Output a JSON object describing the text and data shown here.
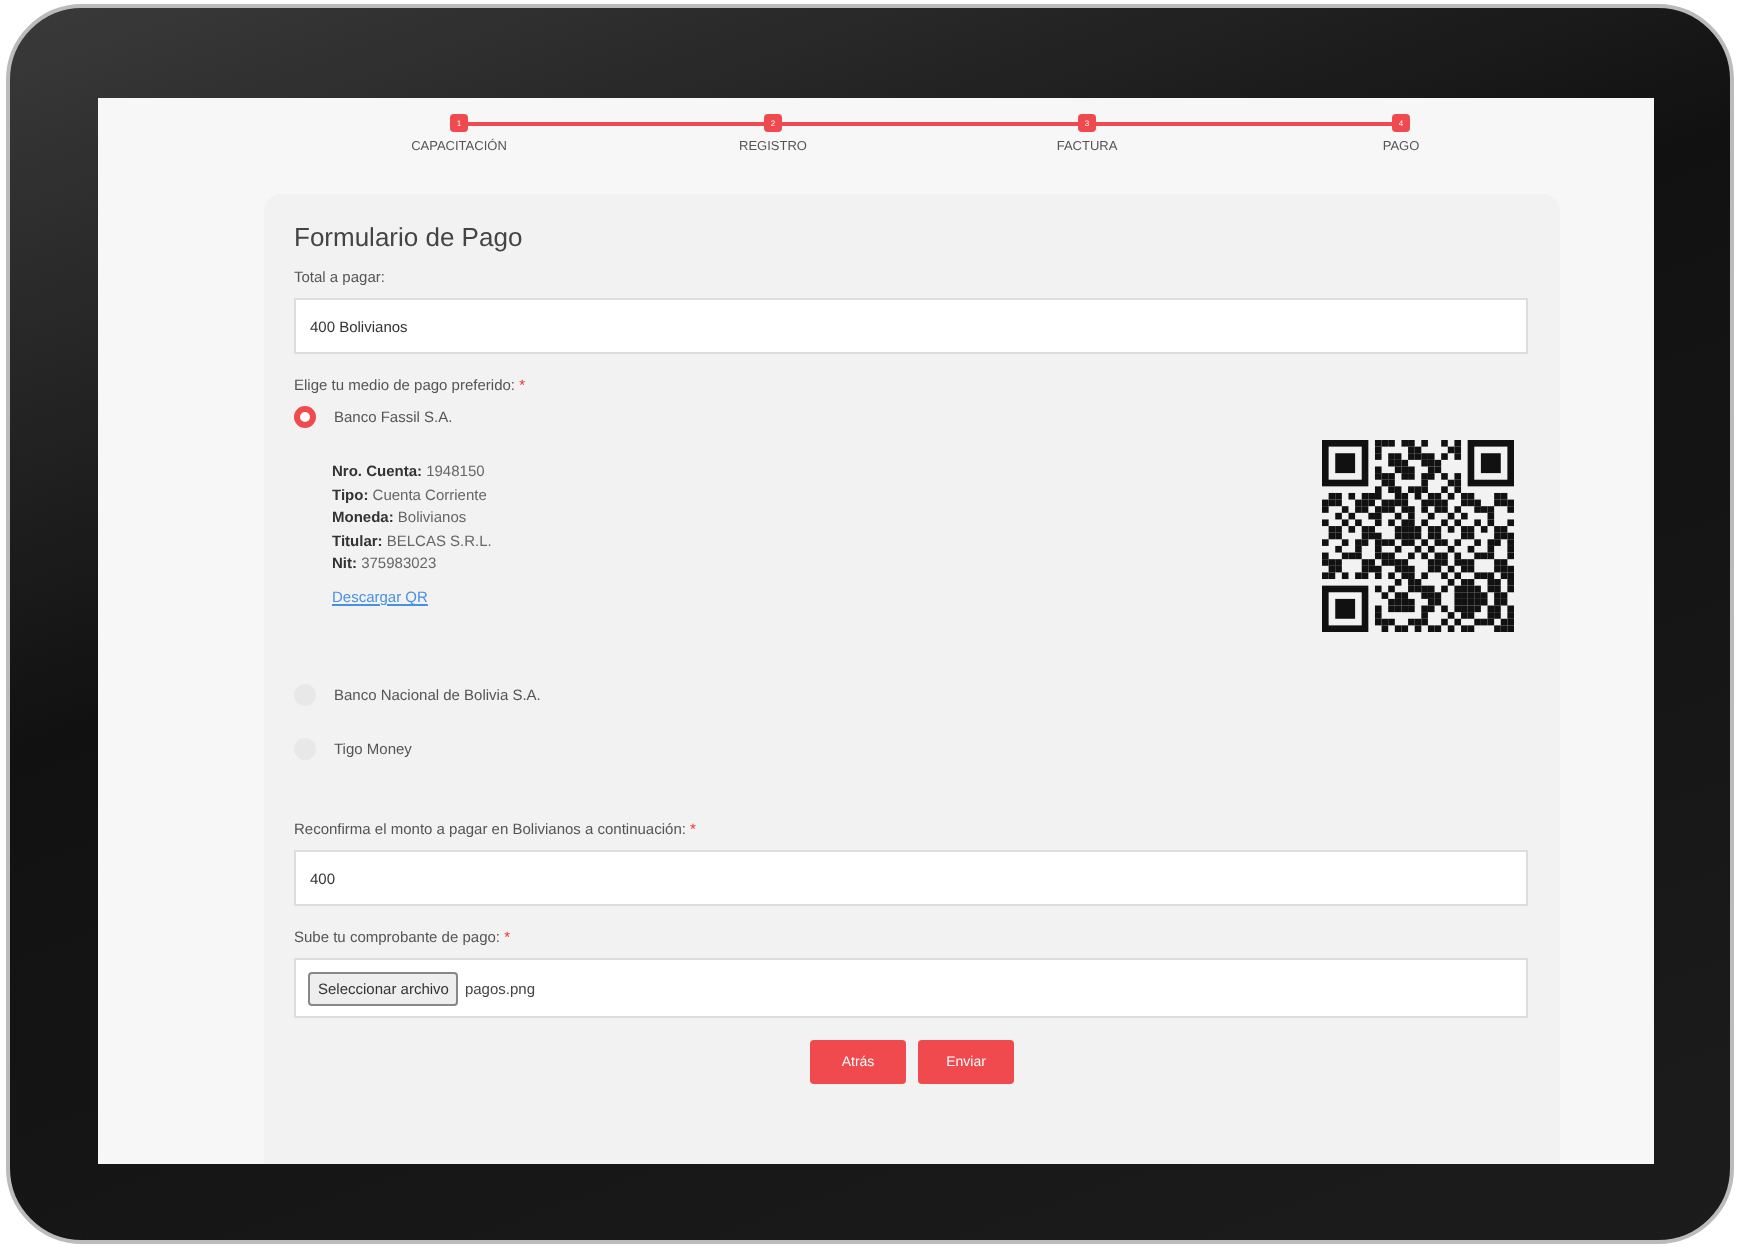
{
  "steps": [
    {
      "number": "1",
      "label": "CAPACITACIÓN",
      "done": true
    },
    {
      "number": "2",
      "label": "REGISTRO",
      "done": true
    },
    {
      "number": "3",
      "label": "FACTURA",
      "done": true
    },
    {
      "number": "4",
      "label": "PAGO",
      "done": true
    }
  ],
  "form": {
    "title": "Formulario de Pago",
    "total_label": "Total a pagar:",
    "total_value": "400 Bolivianos",
    "method_label": "Elige tu medio de pago preferido:",
    "required_mark": "*",
    "methods": [
      {
        "label": "Banco Fassil S.A.",
        "selected": true,
        "details": [
          "**Nro. Cuenta:** 1948150",
          "**Tipo:** Cuenta Corriente",
          "**Moneda:** Bolivianos",
          "**Titular:** BELCAS S.R.L.",
          "**Nit:** 375983023"
        ],
        "link": "Descargar QR"
      },
      {
        "label": "Banco Nacional de Bolivia S.A.",
        "selected": false
      },
      {
        "label": "Tigo Money",
        "selected": false
      }
    ],
    "confirm_label": "Reconfirma el monto a pagar en Bolivianos a continuación:",
    "confirm_value": "400",
    "upload_label": "Sube tu comprobante de pago:",
    "upload_button": "Seleccionar archivo",
    "upload_file": "pagos.png",
    "buttons": [
      "Atrás",
      "Enviar"
    ]
  }
}
